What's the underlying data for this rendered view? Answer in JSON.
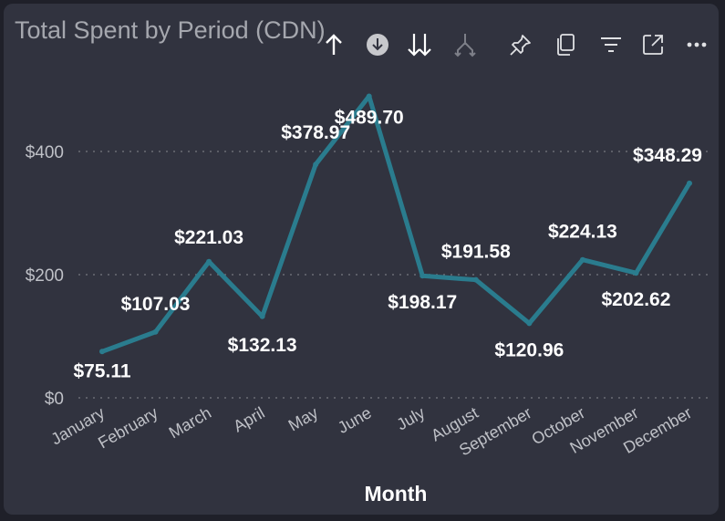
{
  "visual": {
    "title": "Total Spent by Period (CDN)",
    "toolbar": [
      {
        "icon": "arrow-up-icon",
        "label": "Drill up"
      },
      {
        "icon": "drill-down-circle-icon",
        "label": "Drill down on"
      },
      {
        "icon": "double-arrow-down-icon",
        "label": "Go to next level"
      },
      {
        "icon": "expand-hierarchy-icon",
        "label": "Expand all down one level"
      },
      {
        "icon": "pin-icon",
        "label": "Pin visual"
      },
      {
        "icon": "copy-icon",
        "label": "Copy visual"
      },
      {
        "icon": "filter-icon",
        "label": "Filters"
      },
      {
        "icon": "focus-mode-icon",
        "label": "Focus mode"
      },
      {
        "icon": "more-options-icon",
        "label": "More options"
      }
    ]
  },
  "colors": {
    "background": "#31333f",
    "line": "#2a7c8e",
    "gridline": "#6a6c75",
    "text": "#ffffff",
    "muted_text": "#bfc1c7"
  },
  "chart_data": {
    "type": "line",
    "title": "Total Spent by Period (CDN)",
    "xlabel": "Month",
    "ylabel": "",
    "categories": [
      "January",
      "February",
      "March",
      "April",
      "May",
      "June",
      "July",
      "August",
      "September",
      "October",
      "November",
      "December"
    ],
    "series": [
      {
        "values": [
          75.11,
          107.03,
          221.03,
          132.13,
          378.97,
          489.7,
          198.17,
          191.58,
          120.96,
          224.13,
          202.62,
          348.29
        ],
        "labels": [
          "$75.11",
          "$107.03",
          "$221.03",
          "$132.13",
          "$378.97",
          "$489.70",
          "$198.17",
          "$191.58",
          "$120.96",
          "$224.13",
          "$202.62",
          "$348.29"
        ]
      }
    ],
    "ylim": [
      0,
      500
    ],
    "yticks": [
      0,
      200,
      400
    ],
    "ytick_labels": [
      "$0",
      "$200",
      "$400"
    ],
    "grid": true,
    "legend": "none"
  }
}
